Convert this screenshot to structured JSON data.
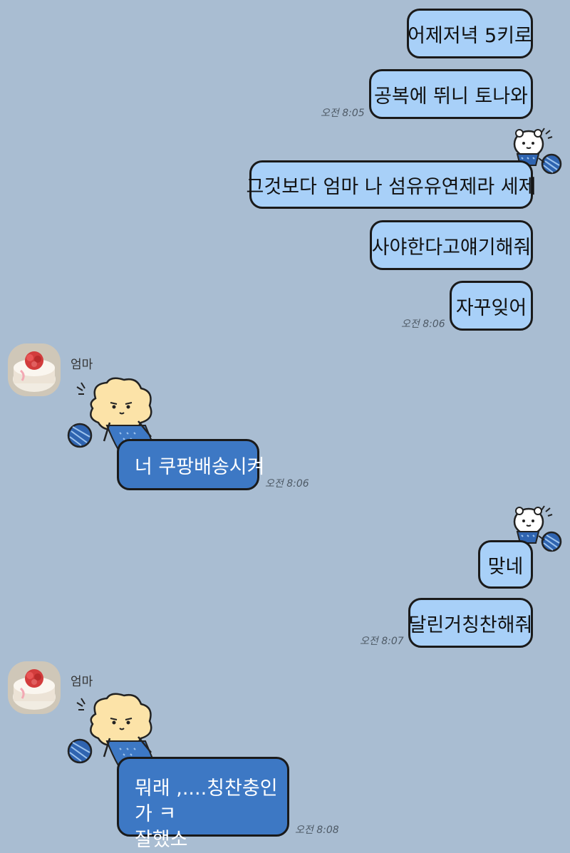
{
  "messages_out": [
    "어제저녁 5키로",
    "공복에 뛰니 토나와",
    "그것보다 엄마 나 섬유유연제라 세제",
    "사야한다고얘기해줘",
    "자꾸잊어",
    "맞네",
    "달린거칭찬해줘"
  ],
  "messages_in": [
    "너 쿠팡배송시켜",
    "뭐래 ,....칭찬충인가 ㅋ",
    "잘했소"
  ],
  "times": [
    "오전 8:05",
    "오전 8:06",
    "오전 8:06",
    "오전 8:07",
    "오전 8:08"
  ],
  "sender_name": "엄마",
  "colors": {
    "background": "#a9bdd2",
    "my_bubble": "#a8d0f8",
    "their_bubble": "#3d78c4",
    "outline": "#1a1a1a",
    "yarn": "#2f64b0",
    "bear": "#fce3a8"
  },
  "icons": {
    "avatar": "carnation-cake-avatar",
    "sticker_small": "white-bear-knitting-sticker",
    "sticker_big": "yellow-bear-knitting-sticker"
  }
}
